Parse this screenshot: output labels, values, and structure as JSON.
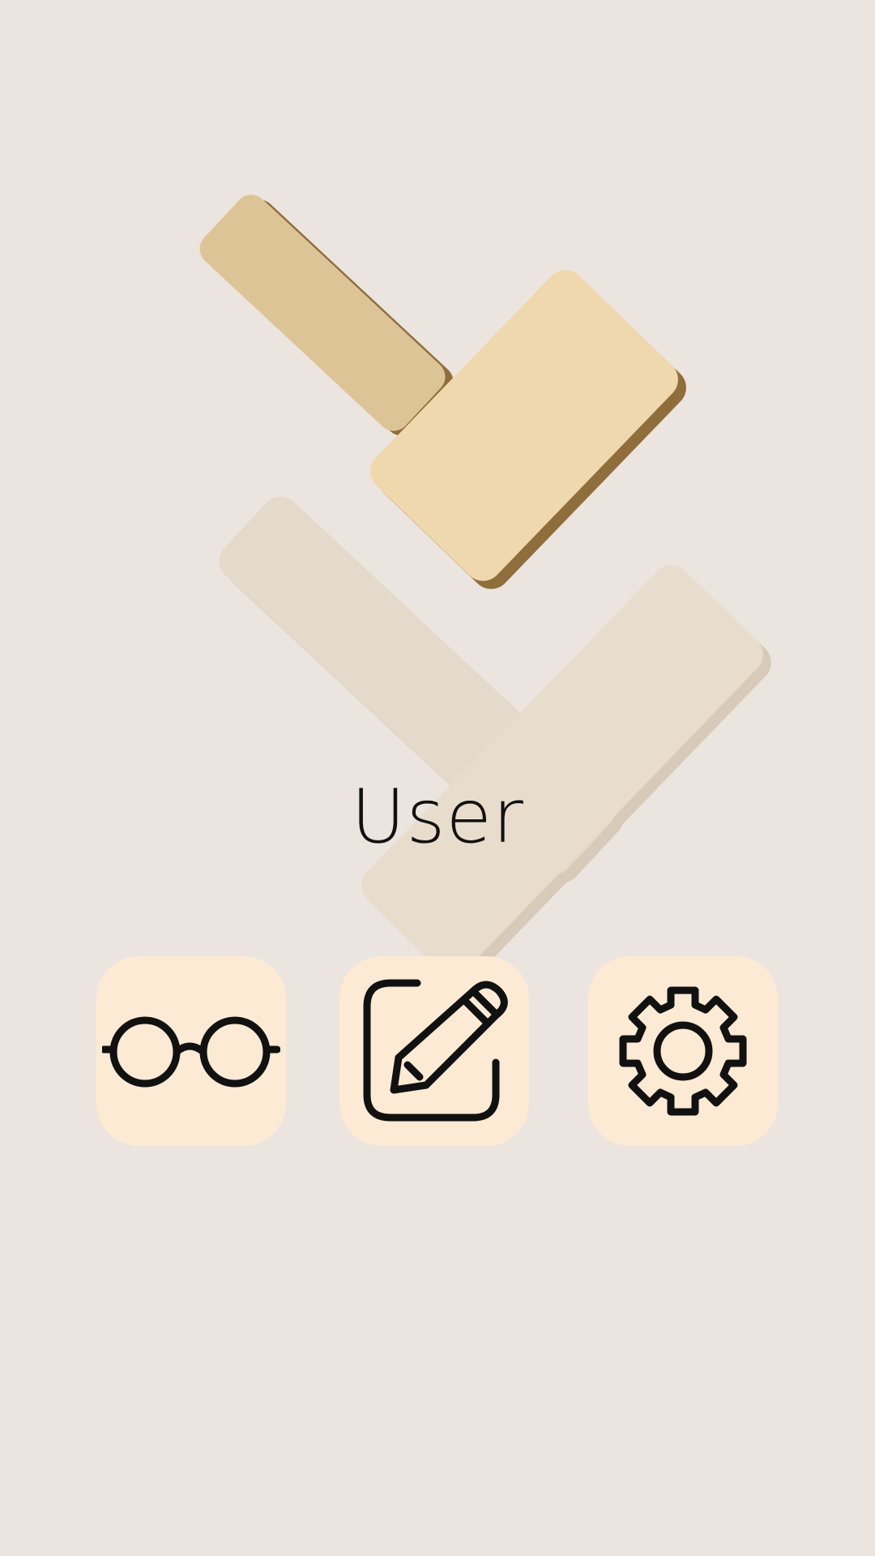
{
  "app": {
    "title": "User"
  },
  "actions": [
    {
      "id": "read",
      "icon": "glasses-icon"
    },
    {
      "id": "edit",
      "icon": "edit-pencil-icon"
    },
    {
      "id": "settings",
      "icon": "gear-icon"
    }
  ],
  "colors": {
    "background": "#ECE4DF",
    "tile": "#FDEAD5",
    "logo_left": "#DDC497",
    "logo_right": "#F0D8AE",
    "logo_shadow": "#8F6E3B",
    "icon_stroke": "#111111"
  }
}
